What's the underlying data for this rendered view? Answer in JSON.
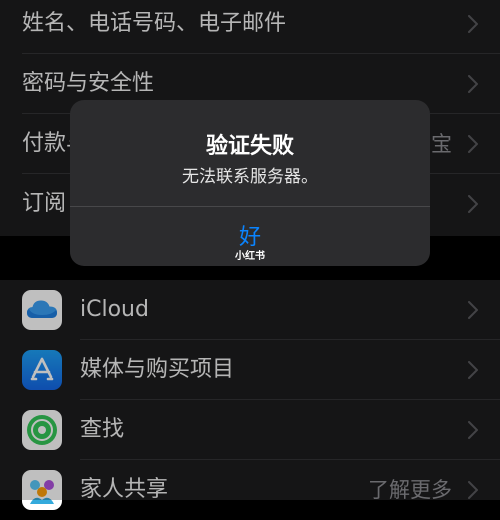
{
  "account_section": {
    "items": [
      {
        "label": "姓名、电话号码、电子邮件"
      },
      {
        "label": "密码与安全性"
      },
      {
        "label": "付款与配送",
        "value": "支付宝"
      },
      {
        "label": "订阅"
      }
    ]
  },
  "services_section": {
    "items": [
      {
        "label": "iCloud",
        "icon": "icloud-icon"
      },
      {
        "label": "媒体与购买项目",
        "icon": "app-store-icon"
      },
      {
        "label": "查找",
        "icon": "find-my-icon"
      },
      {
        "label": "家人共享",
        "icon": "family-sharing-icon",
        "value": "了解更多"
      }
    ]
  },
  "alert": {
    "title": "验证失败",
    "message": "无法联系服务器。",
    "ok_label": "好",
    "watermark": "小红书"
  },
  "colors": {
    "accent": "#0a84ff",
    "row_bg": "#1c1c1e",
    "alert_bg": "#2c2c2e"
  }
}
